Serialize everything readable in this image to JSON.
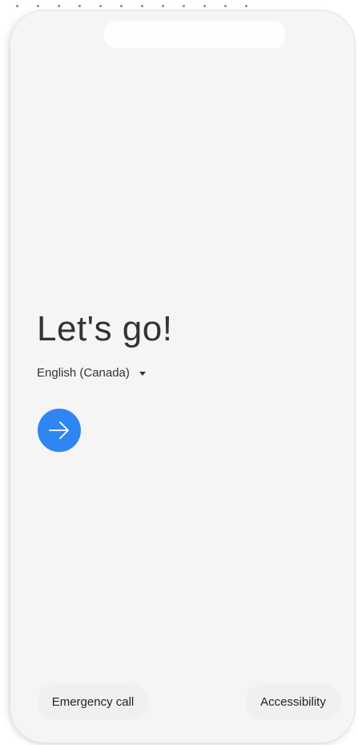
{
  "welcome": {
    "headline": "Let's go!",
    "language": "English (Canada)"
  },
  "icons": {
    "language_dropdown": "caret-down-icon",
    "next": "arrow-right-icon"
  },
  "bottom_bar": {
    "emergency_label": "Emergency call",
    "accessibility_label": "Accessibility"
  },
  "colors": {
    "accent": "#2f86f2",
    "background": "#f5f5f5",
    "text": "#333333"
  }
}
